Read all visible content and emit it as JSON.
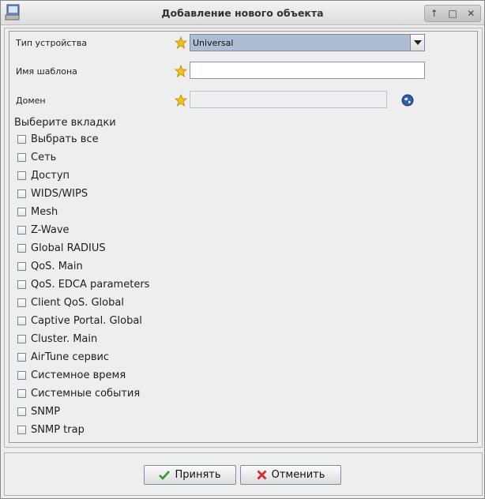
{
  "window": {
    "title": "Добавление нового объекта"
  },
  "form": {
    "device_type_label": "Тип устройства",
    "device_type_value": "Universal",
    "template_name_label": "Имя шаблона",
    "template_name_value": "",
    "domain_label": "Домен",
    "domain_value": ""
  },
  "tabs_section": {
    "title": "Выберите вкладки",
    "items": [
      {
        "label": "Выбрать все",
        "checked": false
      },
      {
        "label": "Сеть",
        "checked": false
      },
      {
        "label": "Доступ",
        "checked": false
      },
      {
        "label": "WIDS/WIPS",
        "checked": false
      },
      {
        "label": "Mesh",
        "checked": false
      },
      {
        "label": "Z-Wave",
        "checked": false
      },
      {
        "label": "Global RADIUS",
        "checked": false
      },
      {
        "label": "QoS. Main",
        "checked": false
      },
      {
        "label": "QoS. EDCA parameters",
        "checked": false
      },
      {
        "label": "Client QoS. Global",
        "checked": false
      },
      {
        "label": "Captive Portal. Global",
        "checked": false
      },
      {
        "label": "Cluster. Main",
        "checked": false
      },
      {
        "label": "AirTune сервис",
        "checked": false
      },
      {
        "label": "Системное время",
        "checked": false
      },
      {
        "label": "Системные события",
        "checked": false
      },
      {
        "label": "SNMP",
        "checked": false
      },
      {
        "label": "SNMP trap",
        "checked": false
      }
    ]
  },
  "footer": {
    "accept_label": "Принять",
    "cancel_label": "Отменить"
  },
  "icons": {
    "required": "star-icon",
    "domain_picker": "globe-icon",
    "accept": "check-icon",
    "cancel": "cross-icon"
  },
  "colors": {
    "required_star": "#f2c21b",
    "combo_selected_bg": "#aebcd4",
    "accept_check": "#2f9a2f",
    "cancel_cross": "#d62b2b"
  }
}
